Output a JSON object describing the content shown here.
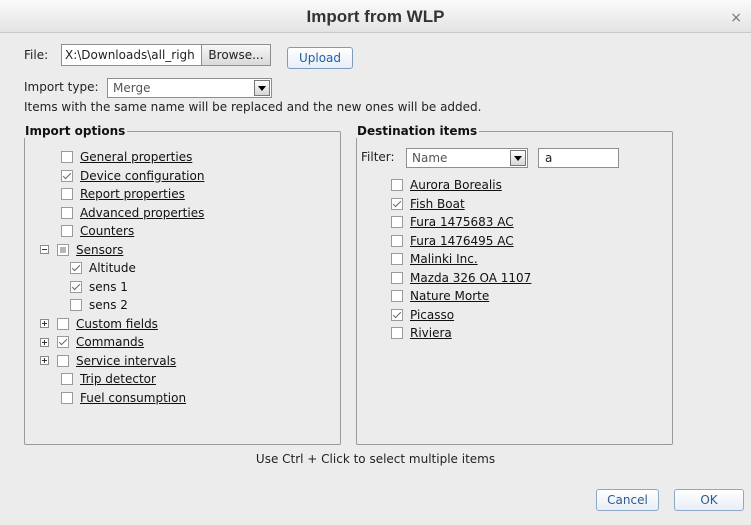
{
  "dialog": {
    "title": "Import from WLP",
    "close_glyph": "×"
  },
  "file": {
    "label": "File:",
    "value": "X:\\Downloads\\all_righ",
    "browse_label": "Browse...",
    "upload_label": "Upload"
  },
  "import_type": {
    "label": "Import type:",
    "selected": "Merge"
  },
  "note": "Items with the same name will be replaced and the new ones will be added.",
  "import_options": {
    "legend": "Import options",
    "items": [
      {
        "label": "General properties",
        "state": "unchecked",
        "toggle": "none",
        "level": 0
      },
      {
        "label": "Device configuration",
        "state": "checked",
        "toggle": "none",
        "level": 0
      },
      {
        "label": "Report properties",
        "state": "unchecked",
        "toggle": "none",
        "level": 0
      },
      {
        "label": "Advanced properties",
        "state": "unchecked",
        "toggle": "none",
        "level": 0
      },
      {
        "label": "Counters",
        "state": "unchecked",
        "toggle": "none",
        "level": 0
      },
      {
        "label": "Sensors",
        "state": "partial",
        "toggle": "minus",
        "level": 0
      },
      {
        "label": "Altitude",
        "state": "checked",
        "toggle": "none",
        "level": 1
      },
      {
        "label": "sens 1",
        "state": "checked",
        "toggle": "none",
        "level": 1
      },
      {
        "label": "sens 2",
        "state": "unchecked",
        "toggle": "none",
        "level": 1
      },
      {
        "label": "Custom fields",
        "state": "unchecked",
        "toggle": "plus",
        "level": 0
      },
      {
        "label": "Commands",
        "state": "checked",
        "toggle": "plus",
        "level": 0
      },
      {
        "label": "Service intervals",
        "state": "unchecked",
        "toggle": "plus",
        "level": 0
      },
      {
        "label": "Trip detector",
        "state": "unchecked",
        "toggle": "none",
        "level": 0
      },
      {
        "label": "Fuel consumption",
        "state": "unchecked",
        "toggle": "none",
        "level": 0
      }
    ]
  },
  "destination": {
    "legend": "Destination items",
    "filter_label": "Filter:",
    "filter_field": "Name",
    "filter_value": "a",
    "items": [
      {
        "label": "Aurora Borealis",
        "checked": false
      },
      {
        "label": "Fish Boat",
        "checked": true
      },
      {
        "label": "Fura 1475683 AC",
        "checked": false
      },
      {
        "label": "Fura 1476495 AC",
        "checked": false
      },
      {
        "label": "Malinki Inc.",
        "checked": false
      },
      {
        "label": "Mazda 326 OA 1107",
        "checked": false
      },
      {
        "label": "Nature Morte",
        "checked": false
      },
      {
        "label": "Picasso",
        "checked": true
      },
      {
        "label": "Riviera",
        "checked": false
      }
    ]
  },
  "hint": "Use Ctrl + Click to select multiple items",
  "buttons": {
    "cancel": "Cancel",
    "ok": "OK"
  }
}
